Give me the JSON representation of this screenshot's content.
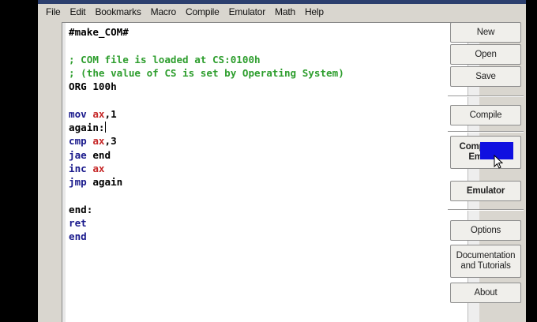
{
  "menu": [
    "File",
    "Edit",
    "Bookmarks",
    "Macro",
    "Compile",
    "Emulator",
    "Math",
    "Help"
  ],
  "editor": {
    "lines": [
      [
        {
          "t": "#make_COM#",
          "c": "lbl"
        }
      ],
      [],
      [
        {
          "t": "; COM file is loaded at CS:0100h",
          "c": "cmt"
        }
      ],
      [
        {
          "t": "; (the value of CS is set by Operating System)",
          "c": "cmt"
        }
      ],
      [
        {
          "t": "ORG 100h",
          "c": "lbl"
        }
      ],
      [],
      [
        {
          "t": "mov ",
          "c": "kw"
        },
        {
          "t": "ax",
          "c": "reg"
        },
        {
          "t": ",1",
          "c": "num"
        }
      ],
      [
        {
          "t": "again:",
          "c": "lbl"
        }
      ],
      [
        {
          "t": "cmp ",
          "c": "kw"
        },
        {
          "t": "ax",
          "c": "reg"
        },
        {
          "t": ",3",
          "c": "num"
        }
      ],
      [
        {
          "t": "jae ",
          "c": "kw"
        },
        {
          "t": "end",
          "c": "lbl"
        }
      ],
      [
        {
          "t": "inc ",
          "c": "kw"
        },
        {
          "t": "ax",
          "c": "reg"
        }
      ],
      [
        {
          "t": "jmp ",
          "c": "kw"
        },
        {
          "t": "again",
          "c": "lbl"
        }
      ],
      [],
      [
        {
          "t": "end:",
          "c": "lbl"
        }
      ],
      [
        {
          "t": "ret",
          "c": "kw"
        }
      ],
      [
        {
          "t": "end",
          "c": "kw"
        }
      ]
    ],
    "cursor_line": 7
  },
  "buttons": {
    "new": "New",
    "open": "Open",
    "save": "Save",
    "compile": "Compile",
    "compile_emulate": "Compile and Emulate",
    "emulator": "Emulator",
    "options": "Options",
    "documentation": "Documentation and Tutorials",
    "about": "About"
  },
  "colors": {
    "keyword": "#1a1a8c",
    "register": "#c62828",
    "comment": "#2e9e2e",
    "overlay": "#1010e0"
  }
}
